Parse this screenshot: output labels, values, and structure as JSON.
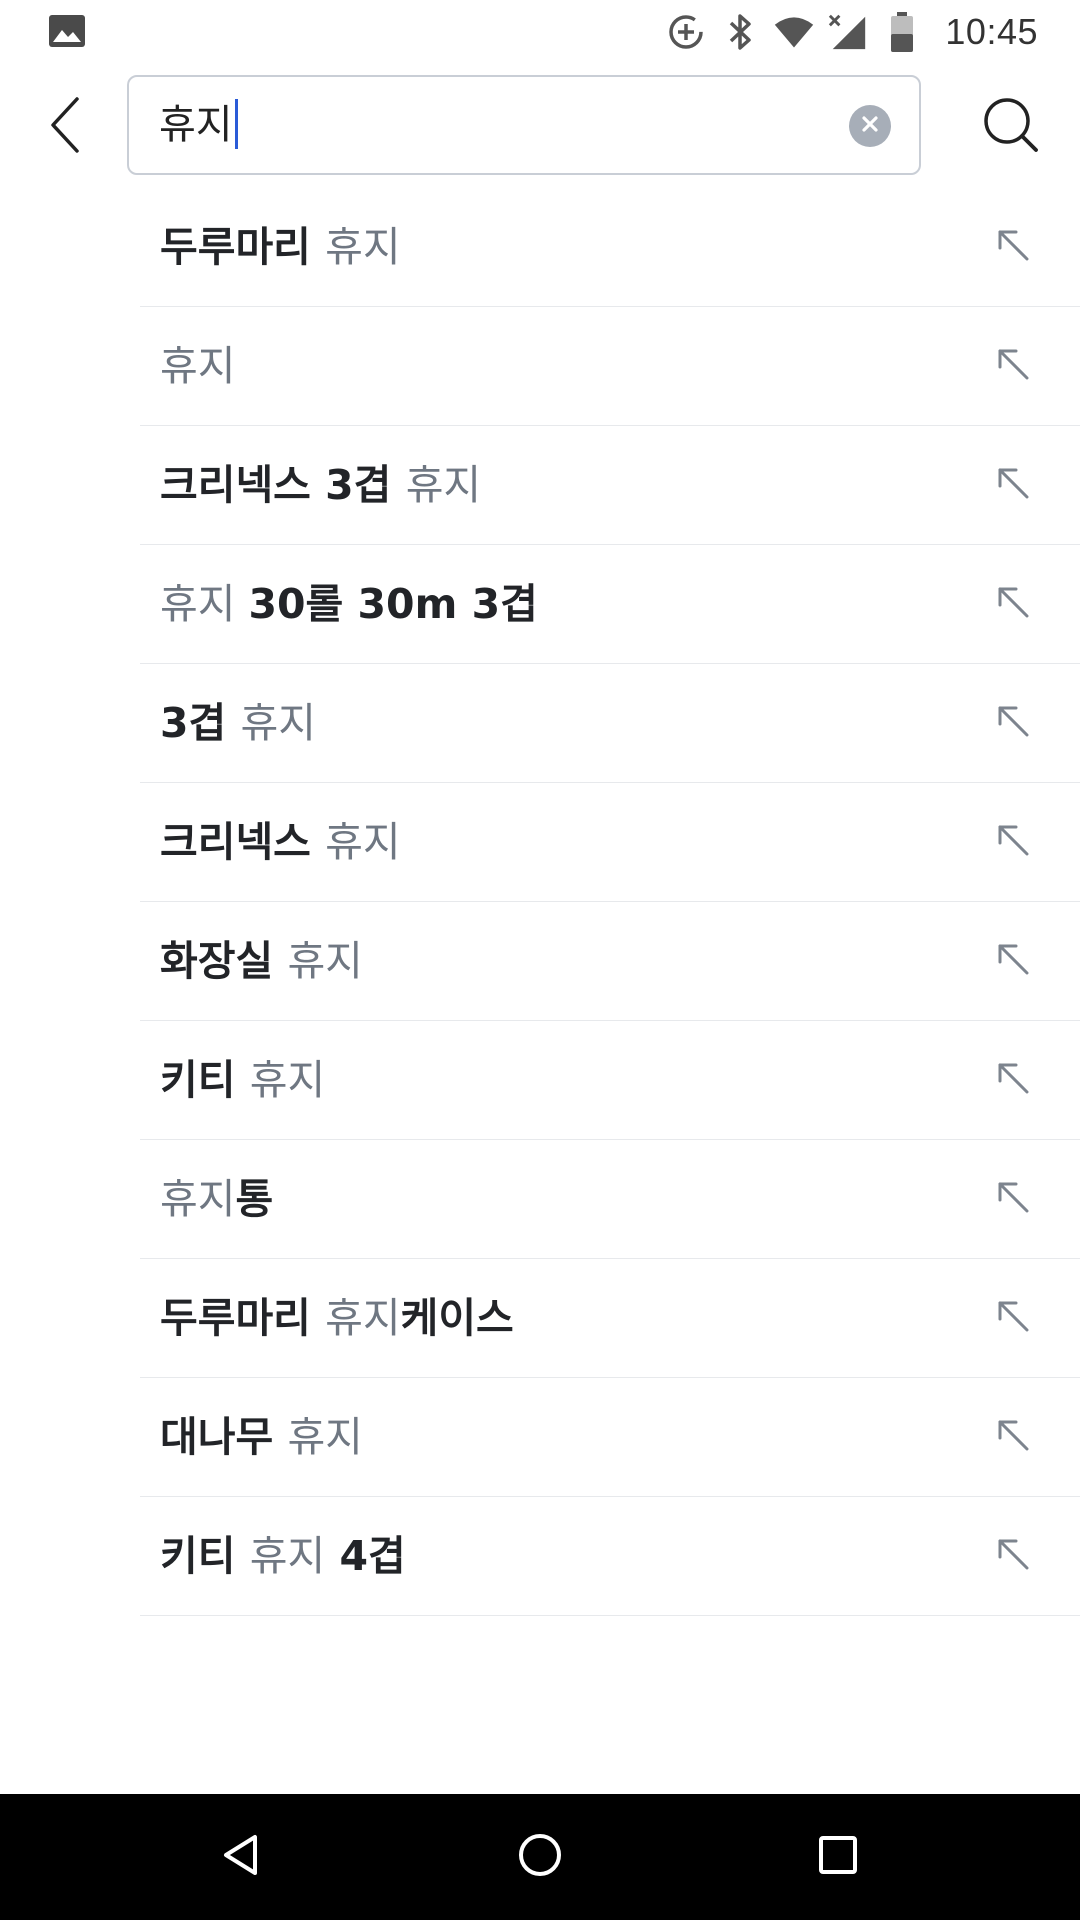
{
  "status_bar": {
    "time": "10:45",
    "icons": [
      "gallery-icon",
      "data-saver-icon",
      "bluetooth-icon",
      "wifi-icon",
      "cellular-no-signal-icon",
      "battery-icon"
    ]
  },
  "search": {
    "query": "휴지",
    "back_icon": "chevron-left-icon",
    "clear_icon": "clear-icon",
    "search_icon": "search-icon"
  },
  "colors": {
    "match_text": "#6f7782",
    "bold_text": "#222428",
    "caret": "#2a5bd7",
    "divider": "#e7e9ec",
    "nav_bar": "#000000"
  },
  "suggestions": [
    {
      "segments": [
        {
          "text": "두루마리 ",
          "style": "bold"
        },
        {
          "text": "휴지",
          "style": "match"
        }
      ]
    },
    {
      "segments": [
        {
          "text": "휴지",
          "style": "match"
        }
      ]
    },
    {
      "segments": [
        {
          "text": "크리넥스 3겹 ",
          "style": "bold"
        },
        {
          "text": "휴지",
          "style": "match"
        }
      ]
    },
    {
      "segments": [
        {
          "text": "휴지 ",
          "style": "match"
        },
        {
          "text": "30롤 30m 3겹",
          "style": "bold"
        }
      ]
    },
    {
      "segments": [
        {
          "text": "3겹 ",
          "style": "bold"
        },
        {
          "text": "휴지",
          "style": "match"
        }
      ]
    },
    {
      "segments": [
        {
          "text": "크리넥스 ",
          "style": "bold"
        },
        {
          "text": "휴지",
          "style": "match"
        }
      ]
    },
    {
      "segments": [
        {
          "text": "화장실 ",
          "style": "bold"
        },
        {
          "text": "휴지",
          "style": "match"
        }
      ]
    },
    {
      "segments": [
        {
          "text": "키티 ",
          "style": "bold"
        },
        {
          "text": "휴지",
          "style": "match"
        }
      ]
    },
    {
      "segments": [
        {
          "text": "휴지",
          "style": "match"
        },
        {
          "text": "통",
          "style": "bold"
        }
      ]
    },
    {
      "segments": [
        {
          "text": "두루마리 ",
          "style": "bold"
        },
        {
          "text": "휴지",
          "style": "match"
        },
        {
          "text": "케이스",
          "style": "bold"
        }
      ]
    },
    {
      "segments": [
        {
          "text": "대나무 ",
          "style": "bold"
        },
        {
          "text": "휴지",
          "style": "match"
        }
      ]
    },
    {
      "segments": [
        {
          "text": "키티 ",
          "style": "bold"
        },
        {
          "text": "휴지",
          "style": "match"
        },
        {
          "text": " 4겹",
          "style": "bold"
        }
      ]
    }
  ],
  "suggestion_action_icon": "arrow-up-left-icon",
  "nav_bar": {
    "icons": [
      "back-triangle-icon",
      "home-circle-icon",
      "recents-square-icon"
    ]
  }
}
